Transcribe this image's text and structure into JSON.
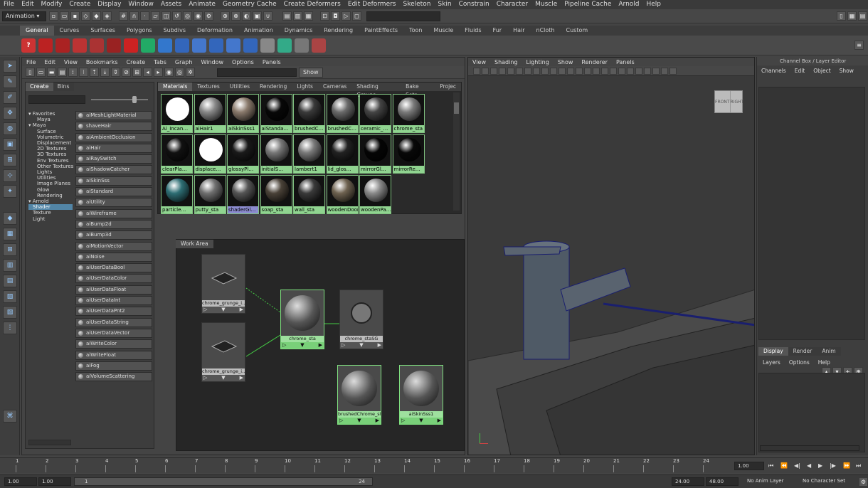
{
  "menubar": [
    "File",
    "Edit",
    "Modify",
    "Create",
    "Display",
    "Window",
    "Assets",
    "Animate",
    "Geometry Cache",
    "Create Deformers",
    "Edit Deformers",
    "Skeleton",
    "Skin",
    "Constrain",
    "Character",
    "Muscle",
    "Pipeline Cache",
    "Arnold",
    "Help"
  ],
  "status": {
    "mode": "Animation"
  },
  "shelf_tabs": [
    "General",
    "Curves",
    "Surfaces",
    "Polygons",
    "Subdivs",
    "Deformation",
    "Animation",
    "Dynamics",
    "Rendering",
    "PaintEffects",
    "Toon",
    "Muscle",
    "Fluids",
    "Fur",
    "Hair",
    "nCloth",
    "Custom"
  ],
  "hypershade": {
    "menu": [
      "File",
      "Edit",
      "View",
      "Bookmarks",
      "Create",
      "Tabs",
      "Graph",
      "Window",
      "Options",
      "Panels"
    ],
    "show_label": "Show",
    "create_tabs": [
      "Create",
      "Bins"
    ],
    "tree": [
      {
        "label": "▾ Favorites",
        "indent": 0
      },
      {
        "label": "Maya",
        "indent": 2
      },
      {
        "label": "▾ Maya",
        "indent": 0
      },
      {
        "label": "Surface",
        "indent": 2
      },
      {
        "label": "Volumetric",
        "indent": 2
      },
      {
        "label": "Displacement",
        "indent": 2
      },
      {
        "label": "2D Textures",
        "indent": 2
      },
      {
        "label": "3D Textures",
        "indent": 2
      },
      {
        "label": "Env Textures",
        "indent": 2
      },
      {
        "label": "Other Textures",
        "indent": 2
      },
      {
        "label": "Lights",
        "indent": 2
      },
      {
        "label": "Utilities",
        "indent": 2
      },
      {
        "label": "Image Planes",
        "indent": 2
      },
      {
        "label": "Glow",
        "indent": 2
      },
      {
        "label": "Rendering",
        "indent": 2
      },
      {
        "label": "▾ Arnold",
        "indent": 0
      },
      {
        "label": "Shader",
        "indent": 1,
        "selected": true
      },
      {
        "label": "Texture",
        "indent": 1
      },
      {
        "label": "Light",
        "indent": 1
      }
    ],
    "nodes": [
      "aiMeshLightMaterial",
      "shaveHair",
      "aiAmbientOcclusion",
      "aiHair",
      "aiRaySwitch",
      "aiShadowCatcher",
      "aiSkinSss",
      "aiStandard",
      "aiUtility",
      "aiWireframe",
      "aiBump2d",
      "aiBump3d",
      "aiMotionVector",
      "aiNoise",
      "aiUserDataBool",
      "aiUserDataColor",
      "aiUserDataFloat",
      "aiUserDataInt",
      "aiUserDataPnt2",
      "aiUserDataString",
      "aiUserDataVector",
      "aiWriteColor",
      "aiWriteFloat",
      "aiFog",
      "aiVolumeScattering"
    ],
    "browser_tabs": [
      "Materials",
      "Textures",
      "Utilities",
      "Rendering",
      "Lights",
      "Cameras",
      "Shading Groups",
      "Bake Sets",
      "Projec"
    ],
    "swatches": [
      {
        "label": "Ai_Incan…",
        "color": "#ffffff"
      },
      {
        "label": "aiHair1",
        "color": "#888888"
      },
      {
        "label": "aiSkinSss1",
        "color": "#8a7a6c"
      },
      {
        "label": "aiStanda…",
        "color": "#080808"
      },
      {
        "label": "brushedC…",
        "color": "#3a3a3a"
      },
      {
        "label": "brushedC…",
        "color": "#6a6a6a"
      },
      {
        "label": "ceramic_…",
        "color": "#444444"
      },
      {
        "label": "chrome_sta",
        "color": "#7a7a7a"
      },
      {
        "label": "clearPla…",
        "color": "#111111"
      },
      {
        "label": "displace…",
        "color": "#ffffff"
      },
      {
        "label": "glossyPl…",
        "color": "#1a1a1a"
      },
      {
        "label": "initialS…",
        "color": "#777777"
      },
      {
        "label": "lambert1",
        "color": "#7a7a7a"
      },
      {
        "label": "lid_glos…",
        "color": "#222222"
      },
      {
        "label": "mirrorGl…",
        "color": "#050505"
      },
      {
        "label": "mirrorRe…",
        "color": "#080808"
      },
      {
        "label": "particle…",
        "color": "#2e6e74"
      },
      {
        "label": "putty_sta",
        "color": "#707070"
      },
      {
        "label": "shaderGl…",
        "color": "#555555",
        "selected": true
      },
      {
        "label": "soap_sta",
        "color": "#4a4238"
      },
      {
        "label": "wall_sta",
        "color": "#3a3a3a"
      },
      {
        "label": "woodenDoor",
        "color": "#6e6250"
      },
      {
        "label": "woodenPa…",
        "color": "#8a8a8a"
      }
    ],
    "work_area_label": "Work Area",
    "graph_nodes": [
      {
        "label": "chrome_grunge_i…",
        "kind": "texture"
      },
      {
        "label": "chrome_grunge_i…",
        "kind": "texture"
      },
      {
        "label": "chrome_sta",
        "kind": "material",
        "selected": true
      },
      {
        "label": "chrome_staSG",
        "kind": "sg"
      },
      {
        "label": "brushedChrome_sta",
        "kind": "material",
        "selected": true
      },
      {
        "label": "aiSkinSss1",
        "kind": "material",
        "selected": true
      }
    ]
  },
  "viewport": {
    "menu": [
      "View",
      "Shading",
      "Lighting",
      "Show",
      "Renderer",
      "Panels"
    ],
    "viewcube": {
      "front": "FRONT",
      "right": "RIGHT"
    }
  },
  "channelbox": {
    "title": "Channel Box / Layer Editor",
    "menu": [
      "Channels",
      "Edit",
      "Object",
      "Show"
    ],
    "layer_tabs": [
      "Display",
      "Render",
      "Anim"
    ],
    "layer_menu": [
      "Layers",
      "Options",
      "Help"
    ]
  },
  "timeline": {
    "ticks": [
      "1",
      "2",
      "3",
      "4",
      "5",
      "6",
      "7",
      "8",
      "9",
      "10",
      "11",
      "12",
      "13",
      "14",
      "15",
      "16",
      "17",
      "18",
      "19",
      "20",
      "21",
      "22",
      "23",
      "24"
    ],
    "current_frame": "1.00",
    "range_start": "1.00",
    "range_start2": "1.00",
    "range_inner_start": "1",
    "range_inner_end": "24",
    "range_end": "24.00",
    "range_end2": "48.00",
    "anim_layer": "No Anim Layer",
    "char_set": "No Character Set"
  }
}
